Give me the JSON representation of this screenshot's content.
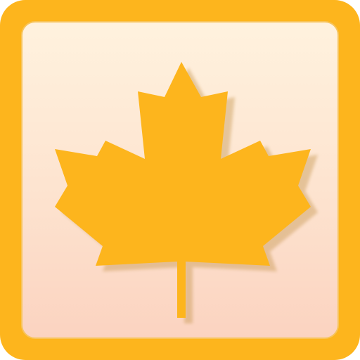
{
  "icon": {
    "name": "maple-leaf-icon",
    "colors": {
      "frame": "#FDB51D",
      "leaf": "#FDB51D",
      "leaf_shadow": "#C89A55",
      "background_top": "#FFF2DE",
      "background_bottom": "#FBD3C0",
      "inner_border": "#F7C45A"
    }
  }
}
